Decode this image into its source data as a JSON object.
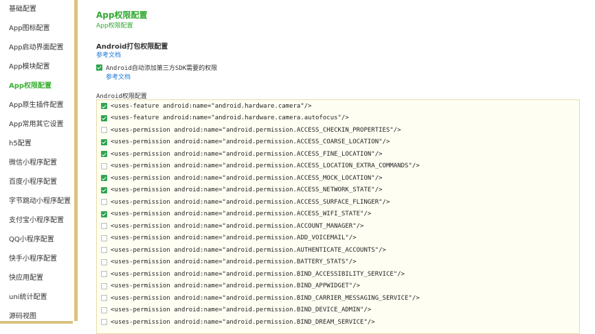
{
  "sidebar": {
    "items": [
      {
        "label": "基础配置",
        "active": false
      },
      {
        "label": "App图标配置",
        "active": false
      },
      {
        "label": "App启动界面配置",
        "active": false
      },
      {
        "label": "App模块配置",
        "active": false
      },
      {
        "label": "App权限配置",
        "active": true
      },
      {
        "label": "App原生插件配置",
        "active": false
      },
      {
        "label": "App常用其它设置",
        "active": false
      },
      {
        "label": "h5配置",
        "active": false
      },
      {
        "label": "微信小程序配置",
        "active": false
      },
      {
        "label": "百度小程序配置",
        "active": false
      },
      {
        "label": "字节跳动小程序配置",
        "active": false
      },
      {
        "label": "支付宝小程序配置",
        "active": false
      },
      {
        "label": "QQ小程序配置",
        "active": false
      },
      {
        "label": "快手小程序配置",
        "active": false
      },
      {
        "label": "快应用配置",
        "active": false
      },
      {
        "label": "uni统计配置",
        "active": false
      },
      {
        "label": "源码视图",
        "active": false
      }
    ]
  },
  "main": {
    "title": "App权限配置",
    "subtitle": "App权限配置",
    "android_section": {
      "title": "Android打包权限配置",
      "doc_link": "参考文档",
      "auto_add": {
        "checked": true,
        "label": "Android自动添加第三方SDK需要的权限"
      },
      "auto_doc_link": "参考文档"
    },
    "permissions_label": "Android权限配置",
    "permissions": [
      {
        "checked": true,
        "text": "<uses-feature android:name=\"android.hardware.camera\"/>"
      },
      {
        "checked": true,
        "text": "<uses-feature android:name=\"android.hardware.camera.autofocus\"/>"
      },
      {
        "checked": false,
        "text": "<uses-permission android:name=\"android.permission.ACCESS_CHECKIN_PROPERTIES\"/>"
      },
      {
        "checked": true,
        "text": "<uses-permission android:name=\"android.permission.ACCESS_COARSE_LOCATION\"/>"
      },
      {
        "checked": true,
        "text": "<uses-permission android:name=\"android.permission.ACCESS_FINE_LOCATION\"/>"
      },
      {
        "checked": false,
        "text": "<uses-permission android:name=\"android.permission.ACCESS_LOCATION_EXTRA_COMMANDS\"/>"
      },
      {
        "checked": true,
        "text": "<uses-permission android:name=\"android.permission.ACCESS_MOCK_LOCATION\"/>"
      },
      {
        "checked": true,
        "text": "<uses-permission android:name=\"android.permission.ACCESS_NETWORK_STATE\"/>"
      },
      {
        "checked": false,
        "text": "<uses-permission android:name=\"android.permission.ACCESS_SURFACE_FLINGER\"/>"
      },
      {
        "checked": true,
        "text": "<uses-permission android:name=\"android.permission.ACCESS_WIFI_STATE\"/>"
      },
      {
        "checked": false,
        "text": "<uses-permission android:name=\"android.permission.ACCOUNT_MANAGER\"/>"
      },
      {
        "checked": false,
        "text": "<uses-permission android:name=\"android.permission.ADD_VOICEMAIL\"/>"
      },
      {
        "checked": false,
        "text": "<uses-permission android:name=\"android.permission.AUTHENTICATE_ACCOUNTS\"/>"
      },
      {
        "checked": false,
        "text": "<uses-permission android:name=\"android.permission.BATTERY_STATS\"/>"
      },
      {
        "checked": false,
        "text": "<uses-permission android:name=\"android.permission.BIND_ACCESSIBILITY_SERVICE\"/>"
      },
      {
        "checked": false,
        "text": "<uses-permission android:name=\"android.permission.BIND_APPWIDGET\"/>"
      },
      {
        "checked": false,
        "text": "<uses-permission android:name=\"android.permission.BIND_CARRIER_MESSAGING_SERVICE\"/>"
      },
      {
        "checked": false,
        "text": "<uses-permission android:name=\"android.permission.BIND_DEVICE_ADMIN\"/>"
      },
      {
        "checked": false,
        "text": "<uses-permission android:name=\"android.permission.BIND_DREAM_SERVICE\"/>"
      }
    ]
  },
  "colors": {
    "accent_green": "#2fa82f",
    "link_blue": "#1c79d8",
    "checkbox_green": "#2ea44f",
    "sidebar_bar": "#d9c27e",
    "box_background": "#fffef3"
  }
}
